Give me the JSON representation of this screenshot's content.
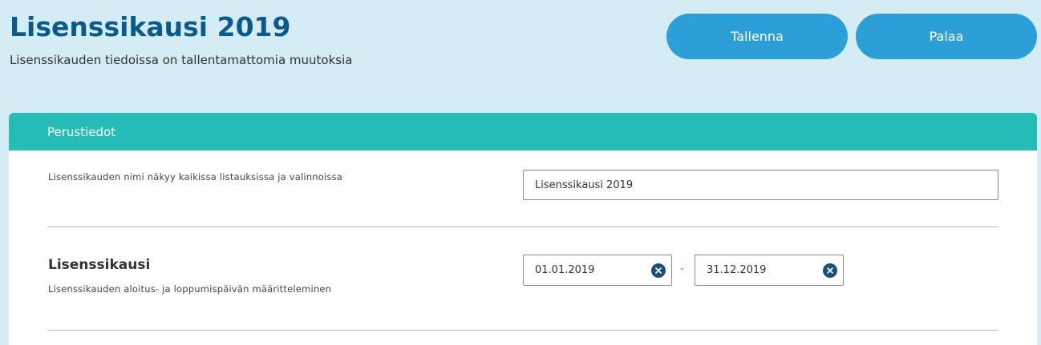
{
  "header": {
    "title": "Lisenssikausi 2019",
    "subtitle": "Lisenssikauden tiedoissa on tallentamattomia muutoksia",
    "save_label": "Tallenna",
    "back_label": "Palaa"
  },
  "colors": {
    "background": "#d4ecf4",
    "title": "#0b5a8c",
    "button": "#2b9fd6",
    "card_header": "#26bdb6",
    "clear_icon": "#17507e"
  },
  "card": {
    "header": "Perustiedot",
    "name_field": {
      "description": "Lisenssikauden nimi näkyy kaikissa listauksissa ja valinnoissa",
      "value": "Lisenssikausi 2019"
    },
    "period": {
      "title": "Lisenssikausi",
      "description": "Lisenssikauden aloitus- ja loppumispäivän määritteleminen",
      "start_date": "01.01.2019",
      "separator": "-",
      "end_date": "31.12.2019",
      "clear_icon": "close-circle-icon"
    }
  }
}
